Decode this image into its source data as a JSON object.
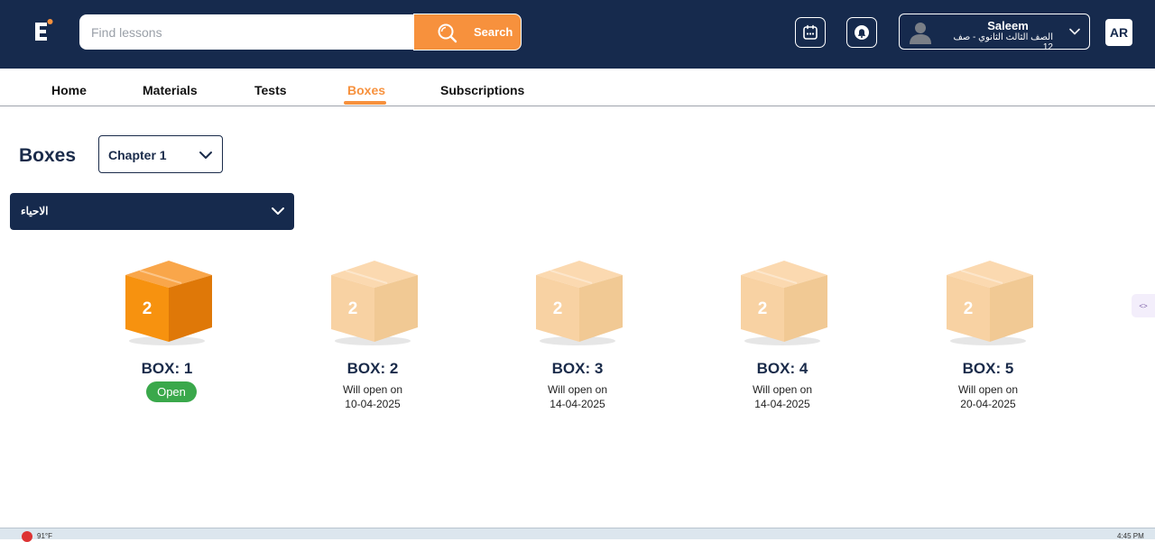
{
  "header": {
    "search_placeholder": "Find lessons",
    "search_label": "Search",
    "user": {
      "name": "Saleem",
      "grade": "الصف الثالث الثانوي - صف 12"
    },
    "lang_label": "AR"
  },
  "nav": {
    "items": [
      {
        "label": "Home"
      },
      {
        "label": "Materials"
      },
      {
        "label": "Tests"
      },
      {
        "label": "Boxes",
        "active": true
      },
      {
        "label": "Subscriptions"
      }
    ]
  },
  "page": {
    "title": "Boxes",
    "chapter_selected": "Chapter 1",
    "subject_selected": "الاحياء"
  },
  "boxes": [
    {
      "title": "BOX: 1",
      "number": "2",
      "state": "open",
      "status_label": "Open"
    },
    {
      "title": "BOX: 2",
      "number": "2",
      "state": "locked",
      "status_line1": "Will open on",
      "status_line2": "10-04-2025"
    },
    {
      "title": "BOX: 3",
      "number": "2",
      "state": "locked",
      "status_line1": "Will open on",
      "status_line2": "14-04-2025"
    },
    {
      "title": "BOX: 4",
      "number": "2",
      "state": "locked",
      "status_line1": "Will open on",
      "status_line2": "14-04-2025"
    },
    {
      "title": "BOX: 5",
      "number": "2",
      "state": "locked",
      "status_line1": "Will open on",
      "status_line2": "20-04-2025"
    }
  ],
  "colors": {
    "header_bg": "#162a4d",
    "accent": "#f7913d",
    "open_green": "#3aa84b",
    "box_active": "#f7910f",
    "box_locked": "#f7cfa0"
  },
  "icons": {
    "logo": "brand-logo-icon",
    "search": "search-icon",
    "calendar": "calendar-icon",
    "bell": "bell-icon",
    "avatar": "user-avatar-icon",
    "chevron": "chevron-down-icon"
  },
  "taskbar": {
    "weather": "91°F",
    "time": "4:45 PM"
  }
}
